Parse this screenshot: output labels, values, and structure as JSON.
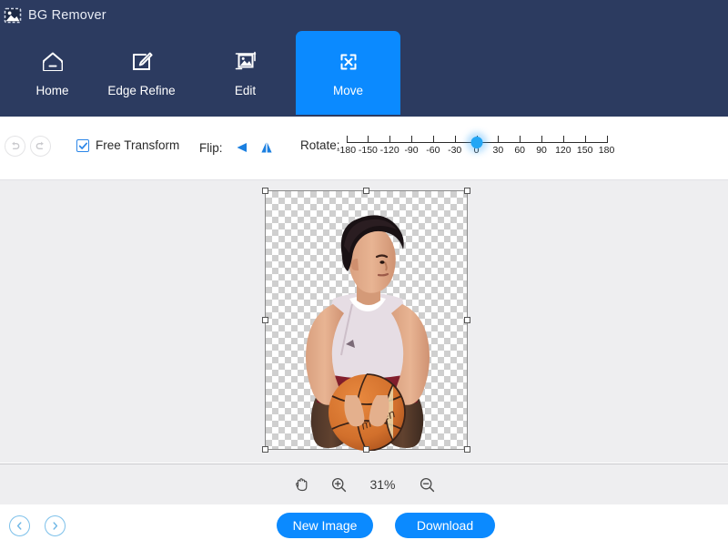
{
  "window": {
    "title": "BG Remover",
    "icon": "image-icon"
  },
  "nav": {
    "tabs": [
      {
        "label": "Home",
        "icon": "home-icon",
        "active": false
      },
      {
        "label": "Edge Refine",
        "icon": "pen-square-icon",
        "active": false
      },
      {
        "label": "Edit",
        "icon": "image-edit-icon",
        "active": false
      },
      {
        "label": "Move",
        "icon": "move-arrows-icon",
        "active": true
      }
    ]
  },
  "toolbar": {
    "undo": {
      "icon": "undo-arrow-icon",
      "enabled": false
    },
    "redo": {
      "icon": "redo-arrow-icon",
      "enabled": false
    },
    "free_transform": {
      "label": "Free Transform",
      "checked": true,
      "icon": "checkbox-checked-icon"
    },
    "flip": {
      "label": "Flip:",
      "horizontal_icon": "flip-horizontal-icon",
      "vertical_icon": "flip-vertical-icon"
    },
    "rotate": {
      "label": "Rotate:",
      "value": 0,
      "min": -180,
      "max": 180,
      "step": 30,
      "ticks": [
        "-180",
        "-150",
        "-120",
        "-90",
        "-60",
        "-30",
        "0",
        "30",
        "60",
        "90",
        "120",
        "150",
        "180"
      ]
    }
  },
  "canvas": {
    "background": "transparent-checkerboard",
    "selection": {
      "handles": 8
    },
    "subject": "person-holding-basketball"
  },
  "zoombar": {
    "hand_tool": {
      "icon": "hand-icon"
    },
    "zoom_in": {
      "icon": "zoom-in-icon"
    },
    "zoom_level": "31%",
    "zoom_out": {
      "icon": "zoom-out-icon"
    }
  },
  "footer": {
    "prev": {
      "icon": "chevron-left-icon"
    },
    "next": {
      "icon": "chevron-right-icon"
    },
    "new_image_label": "New Image",
    "download_label": "Download"
  },
  "colors": {
    "header_navy": "#2c3b60",
    "accent_blue": "#0b8aff",
    "canvas_gray": "#eeeef0",
    "slider_blue": "#23a6f5"
  }
}
